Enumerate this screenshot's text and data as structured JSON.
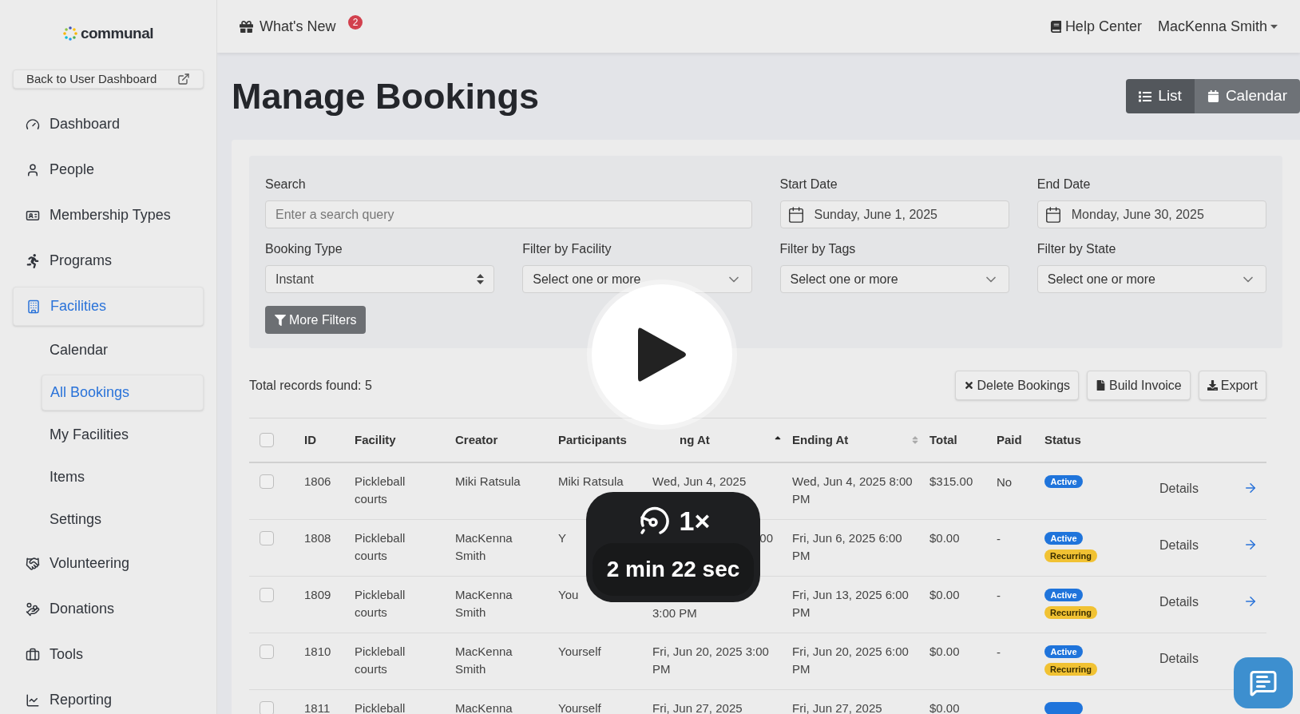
{
  "logo": {
    "text": "communal"
  },
  "sidebar": {
    "back_link": "Back to User Dashboard",
    "items": [
      {
        "label": "Dashboard",
        "selected": false
      },
      {
        "label": "People",
        "selected": false
      },
      {
        "label": "Membership Types",
        "selected": false
      },
      {
        "label": "Programs",
        "selected": false
      },
      {
        "label": "Facilities",
        "selected": true,
        "children": [
          {
            "label": "Calendar",
            "selected": false
          },
          {
            "label": "All Bookings",
            "selected": true
          },
          {
            "label": "My Facilities",
            "selected": false
          },
          {
            "label": "Items",
            "selected": false
          },
          {
            "label": "Settings",
            "selected": false
          }
        ]
      },
      {
        "label": "Volunteering",
        "selected": false
      },
      {
        "label": "Donations",
        "selected": false
      },
      {
        "label": "Tools",
        "selected": false
      },
      {
        "label": "Reporting",
        "selected": false
      }
    ]
  },
  "top_bar": {
    "whats_new": "What's New",
    "whats_new_count": "2",
    "help": "Help Center",
    "user": "MacKenna Smith"
  },
  "page": {
    "title": "Manage Bookings",
    "views": [
      {
        "label": "List",
        "selected": true
      },
      {
        "label": "Calendar",
        "selected": false
      }
    ]
  },
  "filters": {
    "search": {
      "label": "Search",
      "placeholder": "Enter a search query"
    },
    "start_date": {
      "label": "Start Date",
      "value": "Sunday, June 1, 2025"
    },
    "end_date": {
      "label": "End Date",
      "value": "Monday, June 30, 2025"
    },
    "selects": [
      {
        "label": "Booking Type",
        "value": "Instant",
        "kind": "native"
      },
      {
        "label": "Filter by Facility",
        "placeholder": "Select one or more",
        "kind": "multi"
      },
      {
        "label": "Filter by Tags",
        "placeholder": "Select one or more",
        "kind": "multi"
      },
      {
        "label": "Filter by State",
        "placeholder": "Select one or more",
        "kind": "multi"
      }
    ],
    "more_filters": "More Filters"
  },
  "results": {
    "total": "Total records found: 5",
    "actions": [
      "Delete Bookings",
      "Build Invoice",
      "Export"
    ]
  },
  "table": {
    "select_all_checked": false,
    "columns": [
      {
        "label": "ID",
        "sortable": false
      },
      {
        "label": "Facility",
        "sortable": false
      },
      {
        "label": "Creator",
        "sortable": false
      },
      {
        "label": "Participants",
        "sortable": false
      },
      {
        "label": "ng At",
        "sortable": true,
        "sorted": true
      },
      {
        "label": "Ending At",
        "sortable": true,
        "sorted": false
      },
      {
        "label": "Total",
        "sortable": false
      },
      {
        "label": "Paid",
        "sortable": false
      },
      {
        "label": "Status",
        "sortable": false
      }
    ],
    "rows": [
      {
        "checked": false,
        "id": "1806",
        "facility": "Pickleball courts",
        "creator": "Miki Ratsula",
        "participants": "Miki Ratsula",
        "starting": {
          "text": "Wed, Jun 4, 2025",
          "kind": "top"
        },
        "ending": "Wed, Jun 4, 2025 8:00 PM",
        "total": "$315.00",
        "paid": "No",
        "badges": [
          {
            "label": "Active",
            "kind": "active"
          }
        ],
        "details": "Details"
      },
      {
        "checked": false,
        "id": "1808",
        "facility": "Pickleball courts",
        "creator": "MacKenna Smith",
        "participants": "Y",
        "starting": {
          "text": "00",
          "kind": "end"
        },
        "ending": "Fri, Jun 6, 2025 6:00 PM",
        "total": "$0.00",
        "paid": "-",
        "badges": [
          {
            "label": "Active",
            "kind": "active"
          },
          {
            "label": "Recurring",
            "kind": "recurring"
          }
        ],
        "details": "Details"
      },
      {
        "checked": false,
        "id": "1809",
        "facility": "Pickleball courts",
        "creator": "MacKenna Smith",
        "participants": "You",
        "starting": {
          "text": "3:00 PM",
          "kind": "bottom"
        },
        "ending": "Fri, Jun 13, 2025 6:00 PM",
        "total": "$0.00",
        "paid": "-",
        "badges": [
          {
            "label": "Active",
            "kind": "active"
          },
          {
            "label": "Recurring",
            "kind": "recurring"
          }
        ],
        "details": "Details"
      },
      {
        "checked": false,
        "id": "1810",
        "facility": "Pickleball courts",
        "creator": "MacKenna Smith",
        "participants": "Yourself",
        "starting": {
          "text": "Fri, Jun 20, 2025 3:00 PM",
          "kind": "top"
        },
        "ending": "Fri, Jun 20, 2025 6:00 PM",
        "total": "$0.00",
        "paid": "-",
        "badges": [
          {
            "label": "Active",
            "kind": "active"
          },
          {
            "label": "Recurring",
            "kind": "recurring"
          }
        ],
        "details": "Details"
      },
      {
        "checked": false,
        "id": "1811",
        "facility": "Pickleball",
        "creator": "MacKenna",
        "participants": "Yourself",
        "starting": {
          "text": "Fri, Jun 27, 2025",
          "kind": "top"
        },
        "ending": "Fri, Jun 27, 2025",
        "total": "$0.00",
        "badges": [
          {
            "kind": "active"
          }
        ]
      }
    ]
  },
  "video_overlay": {
    "speed": "1×",
    "duration": "2 min 22 sec"
  }
}
